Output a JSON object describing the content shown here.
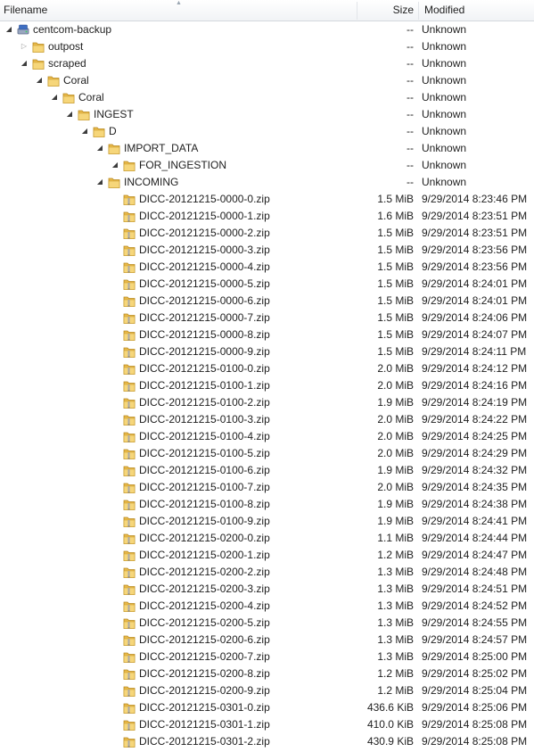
{
  "columns": {
    "filename": "Filename",
    "size": "Size",
    "modified": "Modified"
  },
  "tree": [
    {
      "name": "centcom-backup",
      "depth": 0,
      "kind": "drive",
      "expander": "open",
      "size": "--",
      "modified": "Unknown"
    },
    {
      "name": "outpost",
      "depth": 1,
      "kind": "folder",
      "expander": "closed",
      "size": "--",
      "modified": "Unknown"
    },
    {
      "name": "scraped",
      "depth": 1,
      "kind": "folder",
      "expander": "open",
      "size": "--",
      "modified": "Unknown"
    },
    {
      "name": "Coral",
      "depth": 2,
      "kind": "folder",
      "expander": "open",
      "size": "--",
      "modified": "Unknown"
    },
    {
      "name": "Coral",
      "depth": 3,
      "kind": "folder",
      "expander": "open",
      "size": "--",
      "modified": "Unknown"
    },
    {
      "name": "INGEST",
      "depth": 4,
      "kind": "folder",
      "expander": "open",
      "size": "--",
      "modified": "Unknown"
    },
    {
      "name": "D",
      "depth": 5,
      "kind": "folder",
      "expander": "open",
      "size": "--",
      "modified": "Unknown"
    },
    {
      "name": "IMPORT_DATA",
      "depth": 6,
      "kind": "folder",
      "expander": "open",
      "size": "--",
      "modified": "Unknown"
    },
    {
      "name": "FOR_INGESTION",
      "depth": 7,
      "kind": "folder",
      "expander": "open",
      "size": "--",
      "modified": "Unknown"
    },
    {
      "name": "INCOMING",
      "depth": 6,
      "kind": "folder",
      "expander": "open",
      "size": "--",
      "modified": "Unknown"
    },
    {
      "name": "DICC-20121215-0000-0.zip",
      "depth": 7,
      "kind": "zip",
      "expander": "none",
      "size": "1.5 MiB",
      "modified": "9/29/2014 8:23:46 PM"
    },
    {
      "name": "DICC-20121215-0000-1.zip",
      "depth": 7,
      "kind": "zip",
      "expander": "none",
      "size": "1.6 MiB",
      "modified": "9/29/2014 8:23:51 PM"
    },
    {
      "name": "DICC-20121215-0000-2.zip",
      "depth": 7,
      "kind": "zip",
      "expander": "none",
      "size": "1.5 MiB",
      "modified": "9/29/2014 8:23:51 PM"
    },
    {
      "name": "DICC-20121215-0000-3.zip",
      "depth": 7,
      "kind": "zip",
      "expander": "none",
      "size": "1.5 MiB",
      "modified": "9/29/2014 8:23:56 PM"
    },
    {
      "name": "DICC-20121215-0000-4.zip",
      "depth": 7,
      "kind": "zip",
      "expander": "none",
      "size": "1.5 MiB",
      "modified": "9/29/2014 8:23:56 PM"
    },
    {
      "name": "DICC-20121215-0000-5.zip",
      "depth": 7,
      "kind": "zip",
      "expander": "none",
      "size": "1.5 MiB",
      "modified": "9/29/2014 8:24:01 PM"
    },
    {
      "name": "DICC-20121215-0000-6.zip",
      "depth": 7,
      "kind": "zip",
      "expander": "none",
      "size": "1.5 MiB",
      "modified": "9/29/2014 8:24:01 PM"
    },
    {
      "name": "DICC-20121215-0000-7.zip",
      "depth": 7,
      "kind": "zip",
      "expander": "none",
      "size": "1.5 MiB",
      "modified": "9/29/2014 8:24:06 PM"
    },
    {
      "name": "DICC-20121215-0000-8.zip",
      "depth": 7,
      "kind": "zip",
      "expander": "none",
      "size": "1.5 MiB",
      "modified": "9/29/2014 8:24:07 PM"
    },
    {
      "name": "DICC-20121215-0000-9.zip",
      "depth": 7,
      "kind": "zip",
      "expander": "none",
      "size": "1.5 MiB",
      "modified": "9/29/2014 8:24:11 PM"
    },
    {
      "name": "DICC-20121215-0100-0.zip",
      "depth": 7,
      "kind": "zip",
      "expander": "none",
      "size": "2.0 MiB",
      "modified": "9/29/2014 8:24:12 PM"
    },
    {
      "name": "DICC-20121215-0100-1.zip",
      "depth": 7,
      "kind": "zip",
      "expander": "none",
      "size": "2.0 MiB",
      "modified": "9/29/2014 8:24:16 PM"
    },
    {
      "name": "DICC-20121215-0100-2.zip",
      "depth": 7,
      "kind": "zip",
      "expander": "none",
      "size": "1.9 MiB",
      "modified": "9/29/2014 8:24:19 PM"
    },
    {
      "name": "DICC-20121215-0100-3.zip",
      "depth": 7,
      "kind": "zip",
      "expander": "none",
      "size": "2.0 MiB",
      "modified": "9/29/2014 8:24:22 PM"
    },
    {
      "name": "DICC-20121215-0100-4.zip",
      "depth": 7,
      "kind": "zip",
      "expander": "none",
      "size": "2.0 MiB",
      "modified": "9/29/2014 8:24:25 PM"
    },
    {
      "name": "DICC-20121215-0100-5.zip",
      "depth": 7,
      "kind": "zip",
      "expander": "none",
      "size": "2.0 MiB",
      "modified": "9/29/2014 8:24:29 PM"
    },
    {
      "name": "DICC-20121215-0100-6.zip",
      "depth": 7,
      "kind": "zip",
      "expander": "none",
      "size": "1.9 MiB",
      "modified": "9/29/2014 8:24:32 PM"
    },
    {
      "name": "DICC-20121215-0100-7.zip",
      "depth": 7,
      "kind": "zip",
      "expander": "none",
      "size": "2.0 MiB",
      "modified": "9/29/2014 8:24:35 PM"
    },
    {
      "name": "DICC-20121215-0100-8.zip",
      "depth": 7,
      "kind": "zip",
      "expander": "none",
      "size": "1.9 MiB",
      "modified": "9/29/2014 8:24:38 PM"
    },
    {
      "name": "DICC-20121215-0100-9.zip",
      "depth": 7,
      "kind": "zip",
      "expander": "none",
      "size": "1.9 MiB",
      "modified": "9/29/2014 8:24:41 PM"
    },
    {
      "name": "DICC-20121215-0200-0.zip",
      "depth": 7,
      "kind": "zip",
      "expander": "none",
      "size": "1.1 MiB",
      "modified": "9/29/2014 8:24:44 PM"
    },
    {
      "name": "DICC-20121215-0200-1.zip",
      "depth": 7,
      "kind": "zip",
      "expander": "none",
      "size": "1.2 MiB",
      "modified": "9/29/2014 8:24:47 PM"
    },
    {
      "name": "DICC-20121215-0200-2.zip",
      "depth": 7,
      "kind": "zip",
      "expander": "none",
      "size": "1.3 MiB",
      "modified": "9/29/2014 8:24:48 PM"
    },
    {
      "name": "DICC-20121215-0200-3.zip",
      "depth": 7,
      "kind": "zip",
      "expander": "none",
      "size": "1.3 MiB",
      "modified": "9/29/2014 8:24:51 PM"
    },
    {
      "name": "DICC-20121215-0200-4.zip",
      "depth": 7,
      "kind": "zip",
      "expander": "none",
      "size": "1.3 MiB",
      "modified": "9/29/2014 8:24:52 PM"
    },
    {
      "name": "DICC-20121215-0200-5.zip",
      "depth": 7,
      "kind": "zip",
      "expander": "none",
      "size": "1.3 MiB",
      "modified": "9/29/2014 8:24:55 PM"
    },
    {
      "name": "DICC-20121215-0200-6.zip",
      "depth": 7,
      "kind": "zip",
      "expander": "none",
      "size": "1.3 MiB",
      "modified": "9/29/2014 8:24:57 PM"
    },
    {
      "name": "DICC-20121215-0200-7.zip",
      "depth": 7,
      "kind": "zip",
      "expander": "none",
      "size": "1.3 MiB",
      "modified": "9/29/2014 8:25:00 PM"
    },
    {
      "name": "DICC-20121215-0200-8.zip",
      "depth": 7,
      "kind": "zip",
      "expander": "none",
      "size": "1.2 MiB",
      "modified": "9/29/2014 8:25:02 PM"
    },
    {
      "name": "DICC-20121215-0200-9.zip",
      "depth": 7,
      "kind": "zip",
      "expander": "none",
      "size": "1.2 MiB",
      "modified": "9/29/2014 8:25:04 PM"
    },
    {
      "name": "DICC-20121215-0301-0.zip",
      "depth": 7,
      "kind": "zip",
      "expander": "none",
      "size": "436.6 KiB",
      "modified": "9/29/2014 8:25:06 PM"
    },
    {
      "name": "DICC-20121215-0301-1.zip",
      "depth": 7,
      "kind": "zip",
      "expander": "none",
      "size": "410.0 KiB",
      "modified": "9/29/2014 8:25:08 PM"
    },
    {
      "name": "DICC-20121215-0301-2.zip",
      "depth": 7,
      "kind": "zip",
      "expander": "none",
      "size": "430.9 KiB",
      "modified": "9/29/2014 8:25:08 PM"
    }
  ]
}
